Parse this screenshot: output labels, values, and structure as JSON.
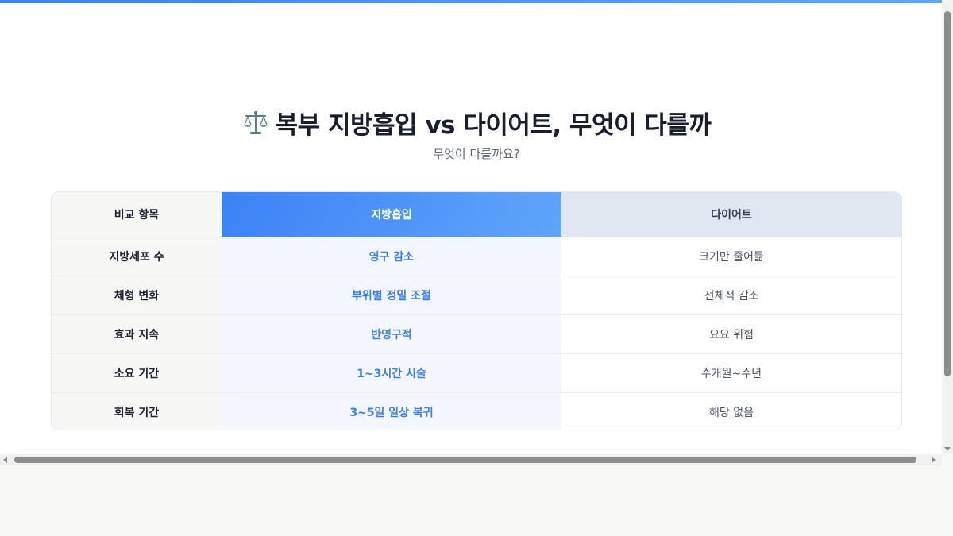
{
  "header": {
    "icon": "balance-scale-icon",
    "title": "복부 지방흡입 vs 다이어트, 무엇이 다를까",
    "subtitle": "무엇이 다를까요?"
  },
  "table": {
    "columns": [
      "비교 항목",
      "지방흡입",
      "다이어트"
    ],
    "rows": [
      {
        "criteria": "지방세포 수",
        "liposuction": "영구 감소",
        "diet": "크기만 줄어듦"
      },
      {
        "criteria": "체형 변화",
        "liposuction": "부위별 정밀 조절",
        "diet": "전체적 감소"
      },
      {
        "criteria": "효과 지속",
        "liposuction": "반영구적",
        "diet": "요요 위험"
      },
      {
        "criteria": "소요 기간",
        "liposuction": "1~3시간 시술",
        "diet": "수개월~수년"
      },
      {
        "criteria": "회복 기간",
        "liposuction": "3~5일 일상 복귀",
        "diet": "해당 없음"
      }
    ]
  },
  "colors": {
    "accent": "#3b82f6",
    "accent_light": "#60a5fa",
    "lipo_text": "#3b7fe6",
    "diet_header_bg": "#e1e7f0"
  }
}
